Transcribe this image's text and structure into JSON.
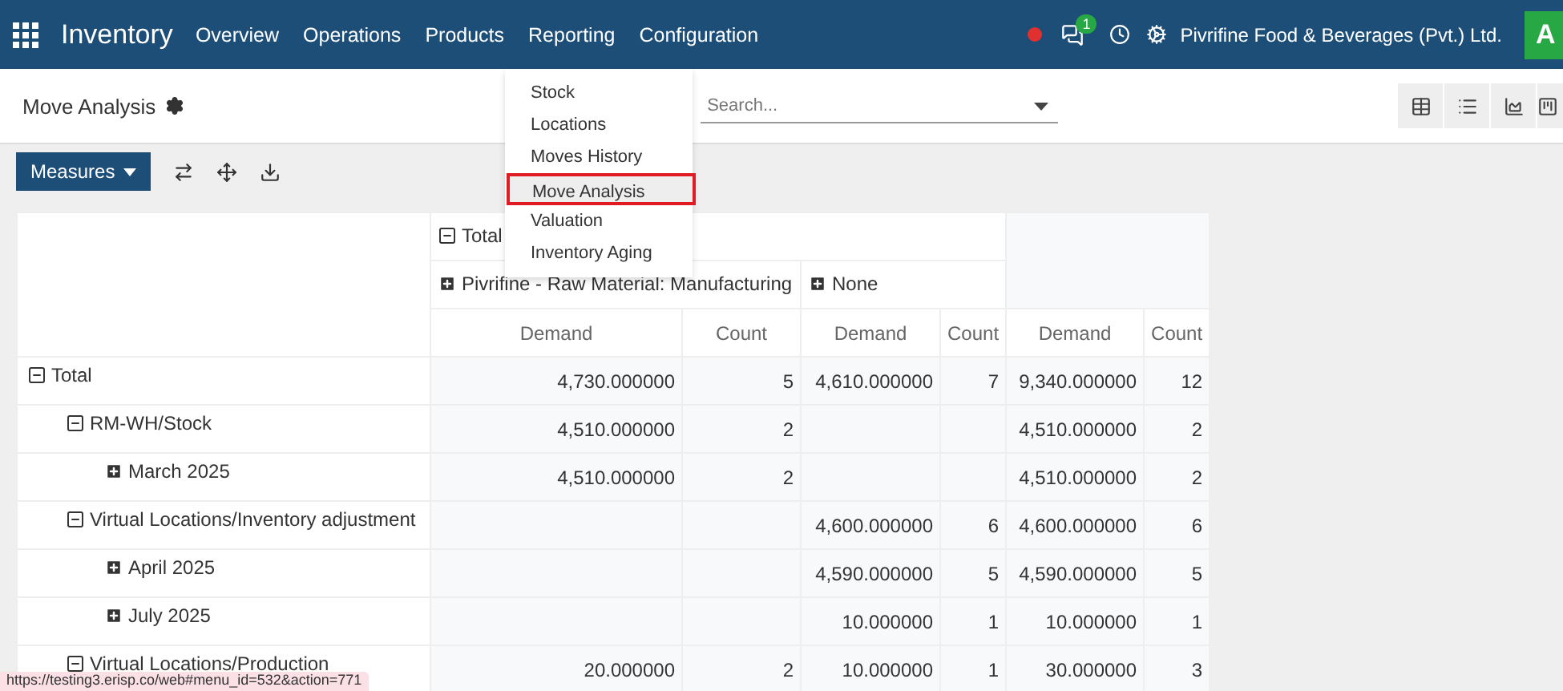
{
  "navbar": {
    "app": "Inventory",
    "menu": [
      "Overview",
      "Operations",
      "Products",
      "Reporting",
      "Configuration"
    ],
    "chat_count": "1",
    "company": "Pivrifine Food & Beverages (Pvt.) Ltd.",
    "avatar": "A"
  },
  "reporting_menu": [
    {
      "label": "Stock",
      "selected": false
    },
    {
      "label": "Locations",
      "selected": false
    },
    {
      "label": "Moves History",
      "selected": false
    },
    {
      "label": "Move Analysis",
      "selected": true
    },
    {
      "label": "Valuation",
      "selected": false
    },
    {
      "label": "Inventory Aging",
      "selected": false
    }
  ],
  "breadcrumb": "Move Analysis",
  "search": {
    "placeholder": "Search..."
  },
  "measures_button": "Measures",
  "pivot": {
    "column_total": {
      "label": "Total",
      "expanded": true
    },
    "column_groups": [
      {
        "label": "Pivrifine - Raw Material: Manufacturing",
        "expanded": false
      },
      {
        "label": "None",
        "expanded": false
      }
    ],
    "measures": [
      "Demand",
      "Count",
      "Demand",
      "Count",
      "Demand",
      "Count"
    ],
    "rows": [
      {
        "label": "Total",
        "expanded": true,
        "cells": [
          "4,730.000000",
          "5",
          "4,610.000000",
          "7",
          "9,340.000000",
          "12"
        ],
        "children": [
          {
            "label": "RM-WH/Stock",
            "expanded": true,
            "cells": [
              "4,510.000000",
              "2",
              null,
              null,
              "4,510.000000",
              "2"
            ],
            "children": [
              {
                "label": "March 2025",
                "expanded": false,
                "cells": [
                  "4,510.000000",
                  "2",
                  null,
                  null,
                  "4,510.000000",
                  "2"
                ]
              }
            ]
          },
          {
            "label": "Virtual Locations/Inventory adjustment",
            "expanded": true,
            "cells": [
              null,
              null,
              "4,600.000000",
              "6",
              "4,600.000000",
              "6"
            ],
            "children": [
              {
                "label": "April 2025",
                "expanded": false,
                "cells": [
                  null,
                  null,
                  "4,590.000000",
                  "5",
                  "4,590.000000",
                  "5"
                ]
              },
              {
                "label": "July 2025",
                "expanded": false,
                "cells": [
                  null,
                  null,
                  "10.000000",
                  "1",
                  "10.000000",
                  "1"
                ]
              }
            ]
          },
          {
            "label": "Virtual Locations/Production",
            "expanded": true,
            "cells": [
              "20.000000",
              "2",
              "10.000000",
              "1",
              "30.000000",
              "3"
            ]
          }
        ]
      }
    ]
  },
  "status_url": "https://testing3.erisp.co/web#menu_id=532&action=771"
}
